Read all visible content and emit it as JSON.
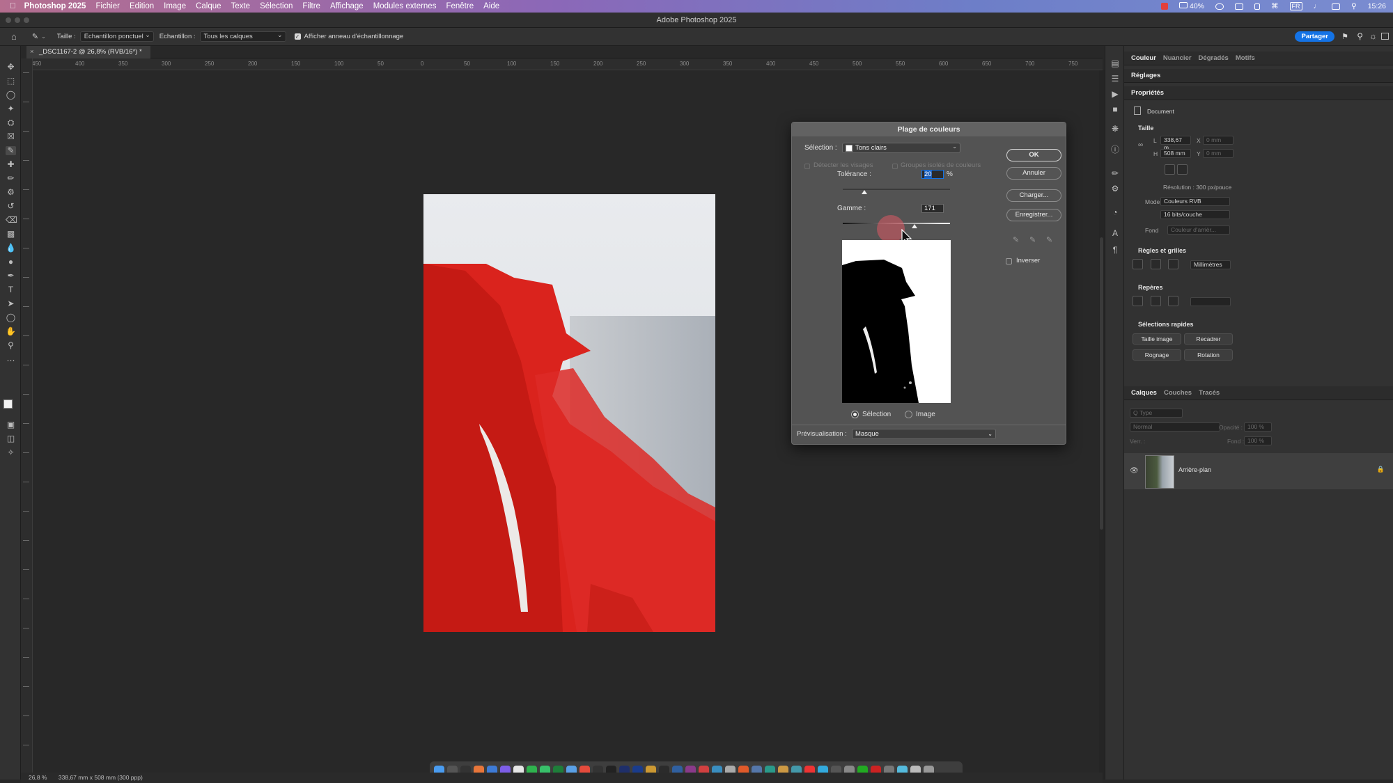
{
  "menubar": {
    "app": "Photoshop 2025",
    "items": [
      "Fichier",
      "Edition",
      "Image",
      "Calque",
      "Texte",
      "Sélection",
      "Filtre",
      "Affichage",
      "Modules externes",
      "Fenêtre",
      "Aide"
    ],
    "battery": "40%",
    "input_source": "FR",
    "clock": "15:26"
  },
  "window": {
    "title": "Adobe Photoshop 2025"
  },
  "options": {
    "size_label": "Taille :",
    "size_value": "Echantillon ponctuel",
    "sample_label": "Echantillon :",
    "sample_value": "Tous les calques",
    "ring_label": "Afficher anneau d'échantillonnage",
    "share": "Partager"
  },
  "document": {
    "tab": "_DSC1167-2 @ 26,8% (RVB/16*) *",
    "zoom": "26,8 %",
    "info": "338,67 mm x 508 mm (300 ppp)"
  },
  "ruler": {
    "h": [
      "450",
      "400",
      "350",
      "300",
      "250",
      "200",
      "150",
      "100",
      "50",
      "0",
      "50",
      "100",
      "150",
      "200",
      "250",
      "300",
      "350",
      "400",
      "450",
      "500",
      "550",
      "600",
      "650",
      "700",
      "750"
    ]
  },
  "dialog": {
    "title": "Plage de couleurs",
    "selection_label": "Sélection :",
    "selection_value": "Tons clairs",
    "detect_faces": "Détecter les visages",
    "localized": "Groupes isolés de couleurs",
    "tolerance_label": "Tolérance :",
    "tolerance_value": "20",
    "percent": "%",
    "range_label": "Gamme :",
    "range_value": "171",
    "ok": "OK",
    "cancel": "Annuler",
    "load": "Charger...",
    "save": "Enregistrer...",
    "invert": "Inverser",
    "radio_selection": "Sélection",
    "radio_image": "Image",
    "preview_label": "Prévisualisation :",
    "preview_value": "Masque",
    "tolerance_fraction": 0.2,
    "range_fraction": 0.67
  },
  "panel": {
    "tabs_top": [
      "Couleur",
      "Nuancier",
      "Dégradés",
      "Motifs"
    ],
    "reglages": "Réglages",
    "proprietes": "Propriétés",
    "document_label": "Document",
    "taille": "Taille",
    "w_label": "L",
    "w_value": "338,67 m",
    "x_label": "X",
    "x_value": "0 mm",
    "h_label": "H",
    "h_value": "508 mm",
    "y_label": "Y",
    "y_value": "0 mm",
    "resolution": "Résolution : 300 px/pouce",
    "mode_label": "Mode",
    "mode_value": "Couleurs RVB",
    "bits_value": "16 bits/couche",
    "fond_label": "Fond",
    "fond_value": "Couleur d'arrièr...",
    "regles": "Règles et grilles",
    "units": "Millimètres",
    "reperes": "Repères",
    "selections_rapides": "Sélections rapides",
    "btn_taille": "Taille image",
    "btn_recadrer": "Recadrer",
    "btn_rognage": "Rognage",
    "btn_rotation": "Rotation",
    "tabs_layers": [
      "Calques",
      "Couches",
      "Tracés"
    ],
    "filter_type": "Q Type",
    "blend": "Normal",
    "opacity_label": "Opacité :",
    "opacity_value": "100 %",
    "lock_label": "Verr. :",
    "fill_label": "Fond :",
    "fill_value": "100 %",
    "layer_name": "Arrière-plan"
  },
  "colors": {
    "accent": "#1473e6",
    "overlay_red": "#d9221c",
    "dialog_bg": "#535353"
  }
}
